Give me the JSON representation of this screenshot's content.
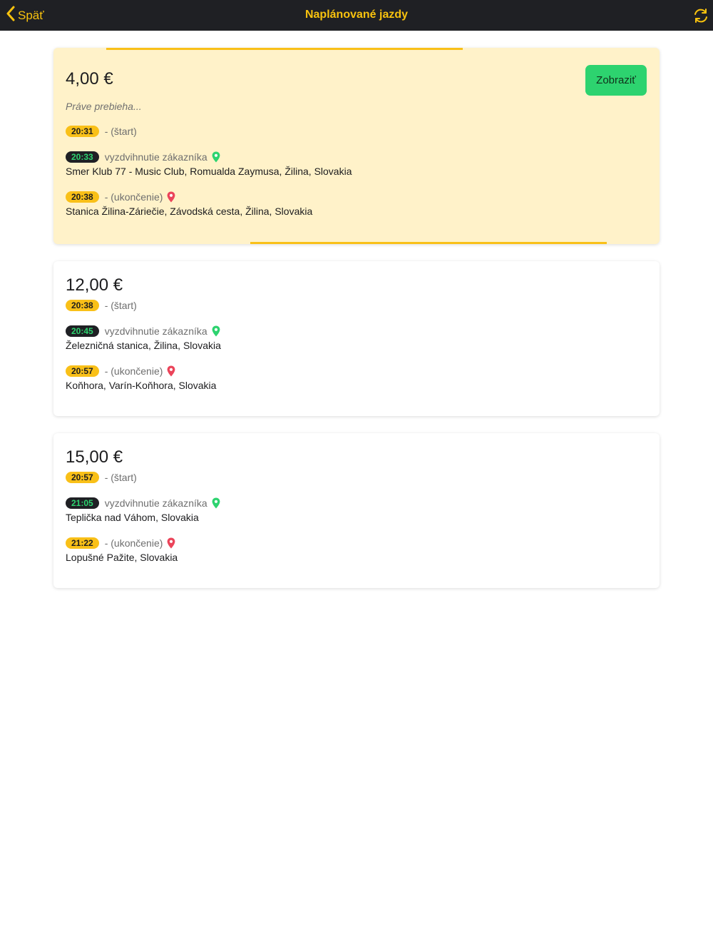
{
  "header": {
    "back_label": "Späť",
    "title": "Naplánované jazdy",
    "refresh_icon": "refresh-icon"
  },
  "colors": {
    "accent": "#f8c20e",
    "navbar": "#1f2024",
    "active_card": "#fff2c9",
    "pickup_green": "#2dd36f",
    "end_red": "#eb445a"
  },
  "rides": [
    {
      "price": "4,00 €",
      "status": "Práve prebieha...",
      "button_label": "Zobraziť",
      "start": {
        "time": "20:31",
        "label": "- (štart)"
      },
      "pickup": {
        "time": "20:33",
        "label": "vyzdvihnutie zákazníka",
        "address": "Smer Klub 77 - Music Club, Romualda Zaymusa, Žilina, Slovakia"
      },
      "end": {
        "time": "20:38",
        "label": "- (ukončenie)",
        "address": "Stanica Žilina-Záriečie, Závodská cesta, Žilina, Slovakia"
      }
    },
    {
      "price": "12,00 €",
      "start": {
        "time": "20:38",
        "label": "- (štart)"
      },
      "pickup": {
        "time": "20:45",
        "label": "vyzdvihnutie zákazníka",
        "address": "Železničná stanica, Žilina, Slovakia"
      },
      "end": {
        "time": "20:57",
        "label": "- (ukončenie)",
        "address": "Koňhora, Varín-Koňhora, Slovakia"
      }
    },
    {
      "price": "15,00 €",
      "start": {
        "time": "20:57",
        "label": "- (štart)"
      },
      "pickup": {
        "time": "21:05",
        "label": "vyzdvihnutie zákazníka",
        "address": "Teplička nad Váhom, Slovakia"
      },
      "end": {
        "time": "21:22",
        "label": "- (ukončenie)",
        "address": "Lopušné Pažite, Slovakia"
      }
    }
  ]
}
